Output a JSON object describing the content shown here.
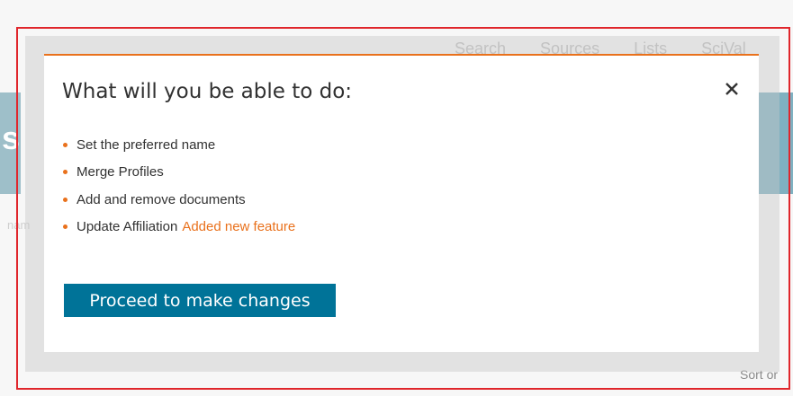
{
  "background": {
    "nav_items": [
      "Search",
      "Sources",
      "Lists",
      "SciVal"
    ],
    "banner_fragment": "s",
    "field_fragment": "nam",
    "sort_fragment": "Sort or"
  },
  "modal": {
    "title": "What will you be able to do:",
    "close_icon": "close-icon",
    "features": [
      {
        "label": "Set the preferred name",
        "badge": ""
      },
      {
        "label": "Merge Profiles",
        "badge": ""
      },
      {
        "label": "Add and remove documents",
        "badge": ""
      },
      {
        "label": "Update Affiliation",
        "badge": "Added new feature"
      }
    ],
    "proceed_label": "Proceed to make changes"
  },
  "colors": {
    "accent": "#e9711c",
    "button": "#007398",
    "highlight_frame": "#e0262c",
    "banner": "#7fb1c1"
  }
}
